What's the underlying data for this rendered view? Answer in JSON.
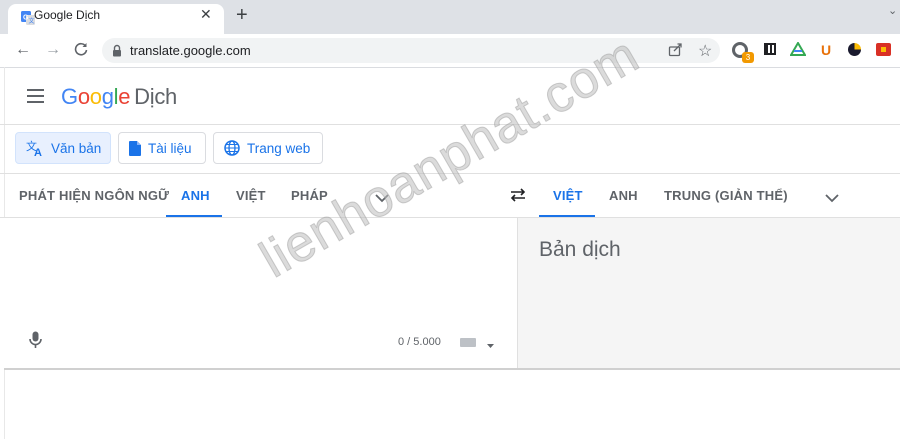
{
  "browser": {
    "tab_title": "Google Dịch",
    "tab_close": "✕",
    "new_tab": "+",
    "url": "translate.google.com",
    "extension_badge": "3"
  },
  "header": {
    "logo_letters": [
      "G",
      "o",
      "o",
      "g",
      "l",
      "e"
    ],
    "logo_colors": [
      "#4285f4",
      "#ea4335",
      "#fbbc05",
      "#4285f4",
      "#34a853",
      "#ea4335"
    ],
    "logo_suffix": "Dịch"
  },
  "modes": {
    "text": "Văn bản",
    "documents": "Tài liệu",
    "websites": "Trang web"
  },
  "source_languages": {
    "detect": "PHÁT HIỆN NGÔN NGỮ",
    "items": [
      "ANH",
      "VIỆT",
      "PHÁP"
    ],
    "selected": "ANH"
  },
  "target_languages": {
    "items": [
      "VIỆT",
      "ANH",
      "TRUNG (GIẢN THỂ)"
    ],
    "selected": "VIỆT"
  },
  "translation": {
    "placeholder": "Bản dịch",
    "char_count": "0 / 5.000"
  },
  "watermark": "lienhoanphat.com",
  "colors": {
    "accent": "#1a73e8",
    "tabstrip": "#dee1e6",
    "target_panel": "#f5f5f5"
  }
}
